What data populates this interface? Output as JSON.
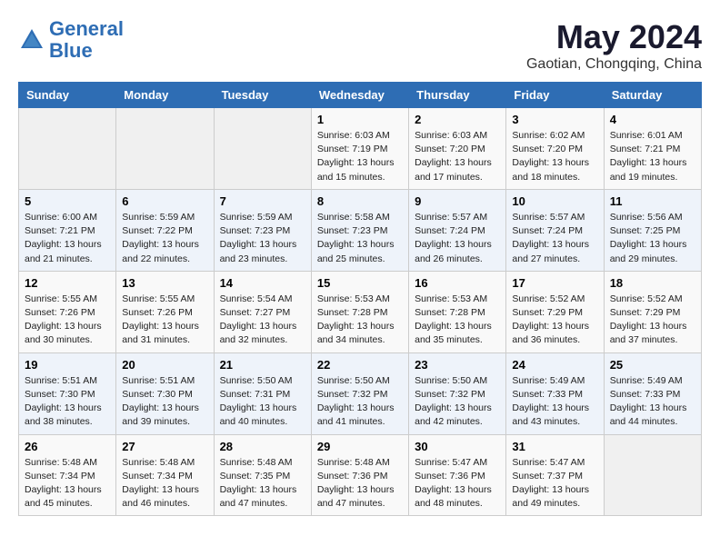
{
  "header": {
    "logo_line1": "General",
    "logo_line2": "Blue",
    "title": "May 2024",
    "subtitle": "Gaotian, Chongqing, China"
  },
  "days_of_week": [
    "Sunday",
    "Monday",
    "Tuesday",
    "Wednesday",
    "Thursday",
    "Friday",
    "Saturday"
  ],
  "weeks": [
    [
      {
        "num": "",
        "info": ""
      },
      {
        "num": "",
        "info": ""
      },
      {
        "num": "",
        "info": ""
      },
      {
        "num": "1",
        "info": "Sunrise: 6:03 AM\nSunset: 7:19 PM\nDaylight: 13 hours and 15 minutes."
      },
      {
        "num": "2",
        "info": "Sunrise: 6:03 AM\nSunset: 7:20 PM\nDaylight: 13 hours and 17 minutes."
      },
      {
        "num": "3",
        "info": "Sunrise: 6:02 AM\nSunset: 7:20 PM\nDaylight: 13 hours and 18 minutes."
      },
      {
        "num": "4",
        "info": "Sunrise: 6:01 AM\nSunset: 7:21 PM\nDaylight: 13 hours and 19 minutes."
      }
    ],
    [
      {
        "num": "5",
        "info": "Sunrise: 6:00 AM\nSunset: 7:21 PM\nDaylight: 13 hours and 21 minutes."
      },
      {
        "num": "6",
        "info": "Sunrise: 5:59 AM\nSunset: 7:22 PM\nDaylight: 13 hours and 22 minutes."
      },
      {
        "num": "7",
        "info": "Sunrise: 5:59 AM\nSunset: 7:23 PM\nDaylight: 13 hours and 23 minutes."
      },
      {
        "num": "8",
        "info": "Sunrise: 5:58 AM\nSunset: 7:23 PM\nDaylight: 13 hours and 25 minutes."
      },
      {
        "num": "9",
        "info": "Sunrise: 5:57 AM\nSunset: 7:24 PM\nDaylight: 13 hours and 26 minutes."
      },
      {
        "num": "10",
        "info": "Sunrise: 5:57 AM\nSunset: 7:24 PM\nDaylight: 13 hours and 27 minutes."
      },
      {
        "num": "11",
        "info": "Sunrise: 5:56 AM\nSunset: 7:25 PM\nDaylight: 13 hours and 29 minutes."
      }
    ],
    [
      {
        "num": "12",
        "info": "Sunrise: 5:55 AM\nSunset: 7:26 PM\nDaylight: 13 hours and 30 minutes."
      },
      {
        "num": "13",
        "info": "Sunrise: 5:55 AM\nSunset: 7:26 PM\nDaylight: 13 hours and 31 minutes."
      },
      {
        "num": "14",
        "info": "Sunrise: 5:54 AM\nSunset: 7:27 PM\nDaylight: 13 hours and 32 minutes."
      },
      {
        "num": "15",
        "info": "Sunrise: 5:53 AM\nSunset: 7:28 PM\nDaylight: 13 hours and 34 minutes."
      },
      {
        "num": "16",
        "info": "Sunrise: 5:53 AM\nSunset: 7:28 PM\nDaylight: 13 hours and 35 minutes."
      },
      {
        "num": "17",
        "info": "Sunrise: 5:52 AM\nSunset: 7:29 PM\nDaylight: 13 hours and 36 minutes."
      },
      {
        "num": "18",
        "info": "Sunrise: 5:52 AM\nSunset: 7:29 PM\nDaylight: 13 hours and 37 minutes."
      }
    ],
    [
      {
        "num": "19",
        "info": "Sunrise: 5:51 AM\nSunset: 7:30 PM\nDaylight: 13 hours and 38 minutes."
      },
      {
        "num": "20",
        "info": "Sunrise: 5:51 AM\nSunset: 7:30 PM\nDaylight: 13 hours and 39 minutes."
      },
      {
        "num": "21",
        "info": "Sunrise: 5:50 AM\nSunset: 7:31 PM\nDaylight: 13 hours and 40 minutes."
      },
      {
        "num": "22",
        "info": "Sunrise: 5:50 AM\nSunset: 7:32 PM\nDaylight: 13 hours and 41 minutes."
      },
      {
        "num": "23",
        "info": "Sunrise: 5:50 AM\nSunset: 7:32 PM\nDaylight: 13 hours and 42 minutes."
      },
      {
        "num": "24",
        "info": "Sunrise: 5:49 AM\nSunset: 7:33 PM\nDaylight: 13 hours and 43 minutes."
      },
      {
        "num": "25",
        "info": "Sunrise: 5:49 AM\nSunset: 7:33 PM\nDaylight: 13 hours and 44 minutes."
      }
    ],
    [
      {
        "num": "26",
        "info": "Sunrise: 5:48 AM\nSunset: 7:34 PM\nDaylight: 13 hours and 45 minutes."
      },
      {
        "num": "27",
        "info": "Sunrise: 5:48 AM\nSunset: 7:34 PM\nDaylight: 13 hours and 46 minutes."
      },
      {
        "num": "28",
        "info": "Sunrise: 5:48 AM\nSunset: 7:35 PM\nDaylight: 13 hours and 47 minutes."
      },
      {
        "num": "29",
        "info": "Sunrise: 5:48 AM\nSunset: 7:36 PM\nDaylight: 13 hours and 47 minutes."
      },
      {
        "num": "30",
        "info": "Sunrise: 5:47 AM\nSunset: 7:36 PM\nDaylight: 13 hours and 48 minutes."
      },
      {
        "num": "31",
        "info": "Sunrise: 5:47 AM\nSunset: 7:37 PM\nDaylight: 13 hours and 49 minutes."
      },
      {
        "num": "",
        "info": ""
      }
    ]
  ]
}
